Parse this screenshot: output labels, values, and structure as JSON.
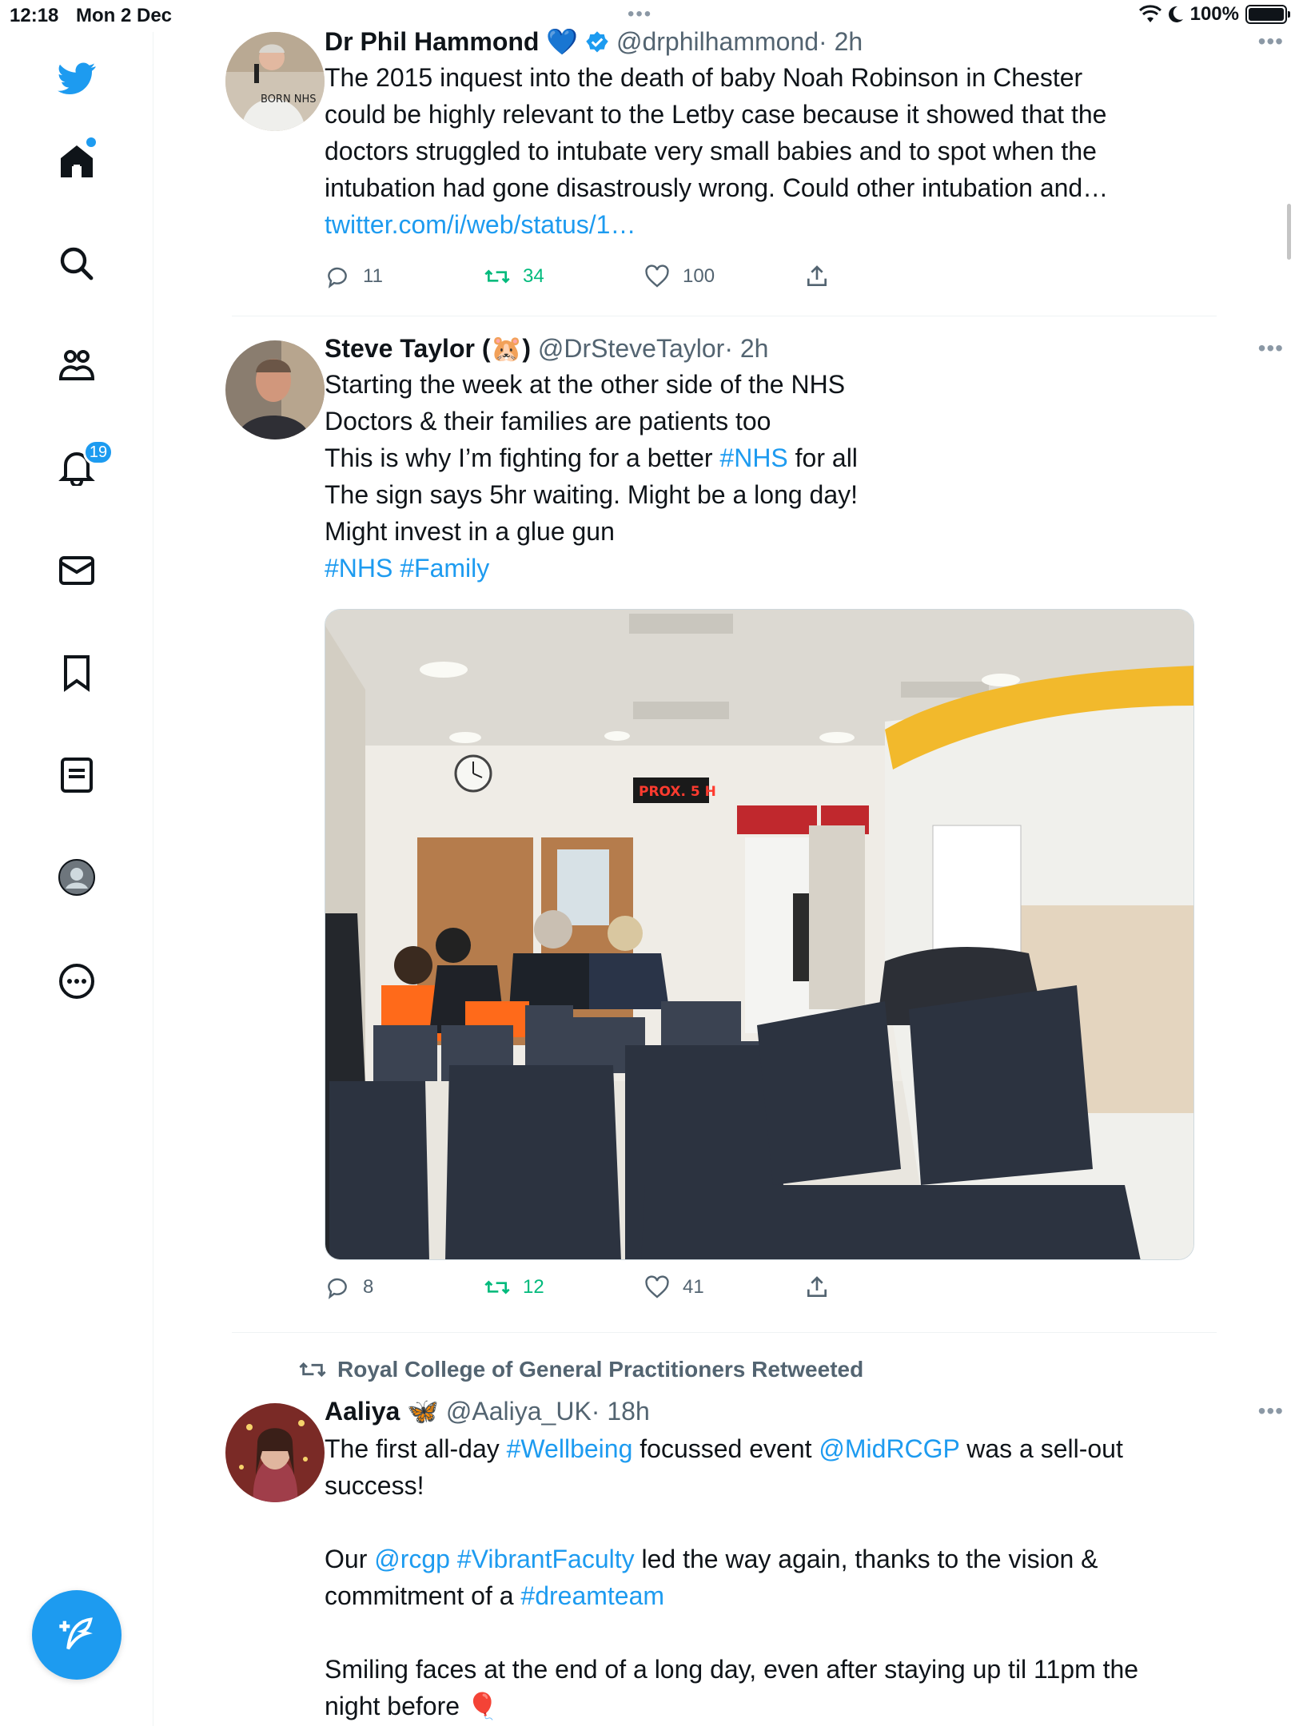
{
  "status_bar": {
    "time": "12:18",
    "date": "Mon 2 Dec",
    "battery": "100%",
    "multitask_dots": "•••"
  },
  "sidebar": {
    "items": [
      {
        "name": "home"
      },
      {
        "name": "explore"
      },
      {
        "name": "communities"
      },
      {
        "name": "notifications",
        "badge": "19"
      },
      {
        "name": "messages"
      },
      {
        "name": "bookmarks"
      },
      {
        "name": "lists"
      },
      {
        "name": "profile"
      },
      {
        "name": "more"
      }
    ]
  },
  "tweets": [
    {
      "name": "Dr Phil Hammond",
      "emoji": "💙",
      "handle": "@drphilhammond",
      "time": "· 2h",
      "more": "•••",
      "text_lines": [
        "The 2015 inquest into the death of baby Noah Robinson in Chester",
        "could be highly relevant to the Letby case because it showed that the",
        "doctors struggled to intubate very small babies and to spot when the",
        "intubation had gone disastrously wrong. Could other intubation and…"
      ],
      "link": "twitter.com/i/web/status/1…",
      "avatar_text": "BORN NHS",
      "replies": "11",
      "retweets": "34",
      "likes": "100"
    },
    {
      "name": "Steve Taylor (",
      "name_end": ")",
      "emoji": "🐹",
      "handle": "@DrSteveTaylor",
      "time": "· 2h",
      "more": "•••",
      "line1": "Starting the week at the other side of the NHS",
      "line2": "Doctors & their families are patients too",
      "line3_pre": "This is why I’m fighting for a better ",
      "line3_tag": "#NHS",
      "line3_post": " for all",
      "line4": "The sign says 5hr waiting. Might be a long day!",
      "line5": "Might invest in a glue gun",
      "tags": "#NHS #Family",
      "photo_sign": "PROX. 5 H",
      "replies": "8",
      "retweets": "12",
      "likes": "41"
    },
    {
      "retweeted_by": "Royal College of General Practitioners Retweeted",
      "name": "Aaliya",
      "emoji": "🦋",
      "handle": "@Aaliya_UK",
      "time": "· 18h",
      "more": "•••",
      "p1_a": "The first all-day ",
      "p1_tag": "#Wellbeing",
      "p1_b": " focussed event ",
      "p1_mention": "@MidRCGP",
      "p1_c": " was a sell-out",
      "p1_d": "success!",
      "p2_a": "Our ",
      "p2_mention": "@rcgp",
      "p2_tag": "#VibrantFaculty",
      "p2_b": " led the way again, thanks to the vision &",
      "p2_c": "commitment of a ",
      "p2_tag2": "#dreamteam",
      "p3_a": "Smiling faces at the end of a long day, even after staying up til 11pm the",
      "p3_b": "night before ",
      "p3_emoji": "🎈"
    }
  ],
  "colors": {
    "accent": "#1d9bf0",
    "retweet": "#00ba7c",
    "secondary": "#536471"
  }
}
